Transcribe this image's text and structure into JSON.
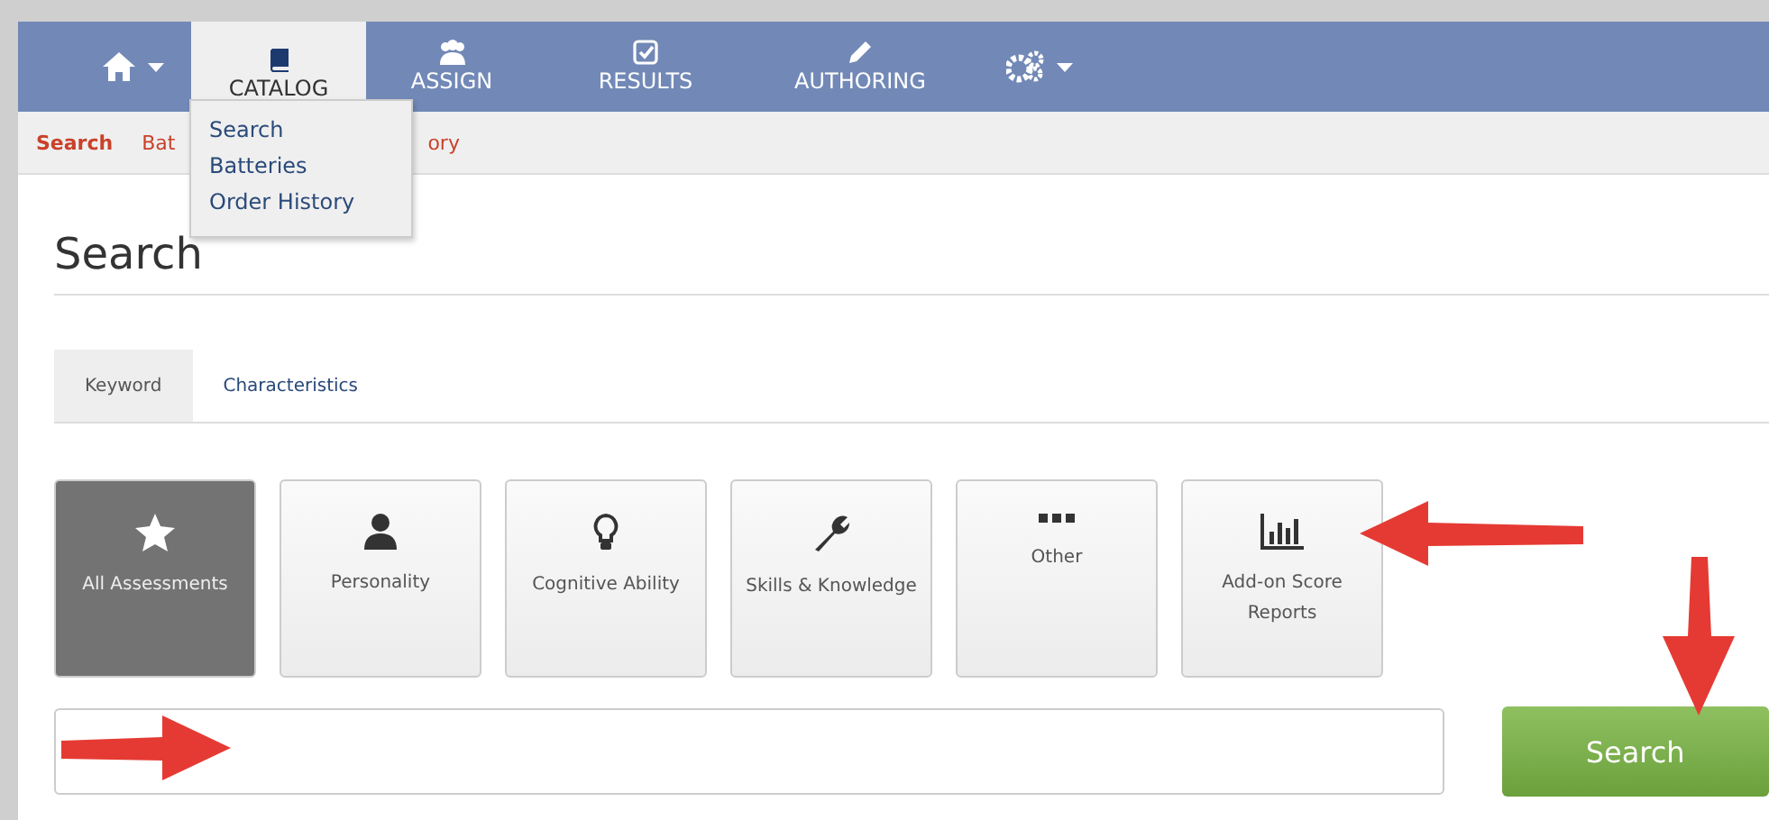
{
  "nav": {
    "items": [
      {
        "kind": "home",
        "selected": false,
        "caret": true
      },
      {
        "kind": "book",
        "label": "CATALOG",
        "selected": true,
        "caret": false
      },
      {
        "kind": "users",
        "label": "ASSIGN",
        "selected": false,
        "caret": false
      },
      {
        "kind": "check",
        "label": "RESULTS",
        "selected": false,
        "caret": false
      },
      {
        "kind": "pencil",
        "label": "AUTHORING",
        "selected": false,
        "caret": false
      },
      {
        "kind": "gears",
        "selected": false,
        "caret": true
      }
    ]
  },
  "dropdown": {
    "items": [
      "Search",
      "Batteries",
      "Order History"
    ]
  },
  "subnav": {
    "items": [
      {
        "label": "Search",
        "selected": true
      },
      {
        "label": "Bat",
        "selected": false
      },
      {
        "label": "ory",
        "selected": false
      }
    ]
  },
  "page_title": "Search",
  "tabs": [
    {
      "label": "Keyword",
      "selected": true
    },
    {
      "label": "Characteristics",
      "selected": false
    }
  ],
  "categories": [
    {
      "kind": "star",
      "label": "All Assessments",
      "selected": true
    },
    {
      "kind": "person",
      "label": "Personality",
      "selected": false
    },
    {
      "kind": "bulb",
      "label": "Cognitive Ability",
      "selected": false
    },
    {
      "kind": "wrench",
      "label": "Skills & Knowledge",
      "selected": false
    },
    {
      "kind": "dots",
      "label": "Other",
      "selected": false
    },
    {
      "kind": "chart",
      "label": "Add-on Score Reports",
      "selected": false
    }
  ],
  "search_button": "Search",
  "callout_arrows": [
    {
      "kind": "left"
    },
    {
      "kind": "down"
    },
    {
      "kind": "right"
    }
  ]
}
